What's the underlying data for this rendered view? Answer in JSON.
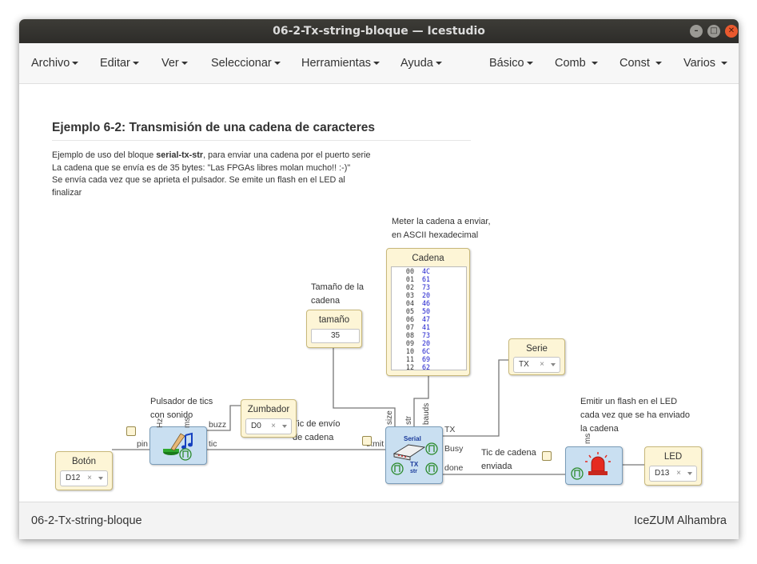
{
  "window": {
    "title": "06-2-Tx-string-bloque — Icestudio"
  },
  "menu_left": [
    "Archivo",
    "Editar",
    "Ver",
    "Seleccionar",
    "Herramientas",
    "Ayuda"
  ],
  "menu_right": [
    "Básico",
    "Comb",
    "Const",
    "Varios"
  ],
  "heading": "Ejemplo 6-2: Transmisión de una cadena de caracteres",
  "description": {
    "line1_pre": "Ejemplo de uso del bloque ",
    "line1_bold": "serial-tx-str",
    "line1_post": ", para enviar una cadena por el puerto serie",
    "line2": "La cadena que se envía es de 35 bytes: \"Las FPGAs libres molan mucho!! :-)\"",
    "line3": "Se envía cada vez que se aprieta el pulsador. Se emite un flash en el LED al",
    "line4": "finalizar"
  },
  "notes": {
    "meter1": "Meter la cadena a enviar,",
    "meter2": "en ASCII hexadecimal",
    "tam1": "Tamaño de la",
    "tam2": "cadena",
    "puls1": "Pulsador de tics",
    "puls2": "con sonido",
    "tic1": "Tic de envío",
    "tic2": "de cadena",
    "ticc1": "Tic de cadena",
    "ticc2": "enviada",
    "emit1": "Emitir un flash en el LED",
    "emit2": "cada vez que se ha enviado",
    "emit3": "la cadena"
  },
  "cadena": {
    "title": "Cadena",
    "rows": [
      {
        "addr": "00",
        "val": "4C"
      },
      {
        "addr": "01",
        "val": "61"
      },
      {
        "addr": "02",
        "val": "73"
      },
      {
        "addr": "03",
        "val": "20"
      },
      {
        "addr": "04",
        "val": "46"
      },
      {
        "addr": "05",
        "val": "50"
      },
      {
        "addr": "06",
        "val": "47"
      },
      {
        "addr": "07",
        "val": "41"
      },
      {
        "addr": "08",
        "val": "73"
      },
      {
        "addr": "09",
        "val": "20"
      },
      {
        "addr": "10",
        "val": "6C"
      },
      {
        "addr": "11",
        "val": "69"
      },
      {
        "addr": "12",
        "val": "62"
      }
    ]
  },
  "tamano": {
    "title": "tamaño",
    "value": "35"
  },
  "serie": {
    "title": "Serie",
    "value": "TX",
    "clear": "×"
  },
  "zumbador": {
    "title": "Zumbador",
    "value": "D0",
    "clear": "×"
  },
  "boton": {
    "title": "Botón",
    "value": "D12",
    "clear": "×"
  },
  "led": {
    "title": "LED",
    "value": "D13",
    "clear": "×"
  },
  "pulsador_block": {
    "pin_in": "pin",
    "pin_hz": "Hz",
    "pin_ms": "ms",
    "pin_buzz": "buzz",
    "pin_tic": "tic"
  },
  "serial_block": {
    "label1": "Serial",
    "label2": "TX",
    "label3": "str",
    "pin_size": "size",
    "pin_str": "str",
    "pin_bauds": "bauds",
    "pin_txmit": "txmit",
    "pin_tx": "TX",
    "pin_busy": "Busy",
    "pin_done": "done"
  },
  "flash_block": {
    "pin_ms": "ms"
  },
  "footer": {
    "left": "06-2-Tx-string-bloque",
    "right": "IceZUM Alhambra"
  },
  "colors": {
    "block": "#c9dff1",
    "io": "#fdf5d6",
    "wire": "#777777",
    "titlebar": "#2d2c29",
    "close": "#e9592e"
  }
}
